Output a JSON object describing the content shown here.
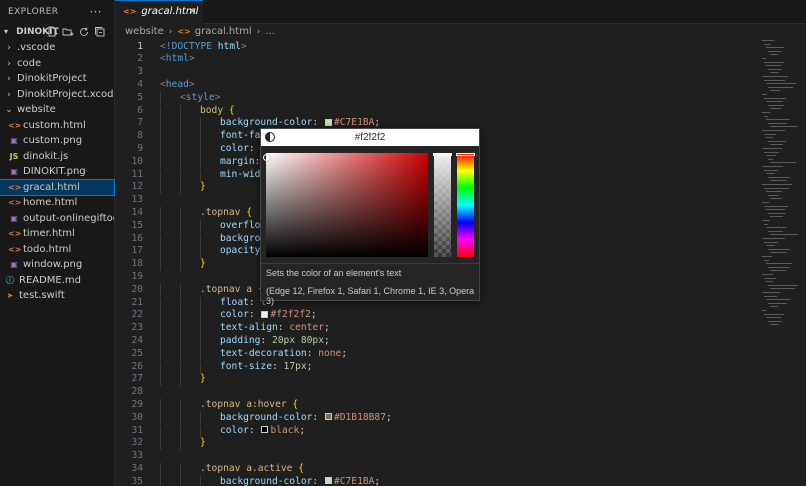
{
  "explorer": {
    "title": "EXPLORER",
    "more": "···",
    "section": "DINOKIT",
    "tree": [
      {
        "label": ".vscode",
        "type": "folder",
        "level": 0,
        "expanded": false
      },
      {
        "label": "code",
        "type": "folder",
        "level": 0,
        "expanded": false
      },
      {
        "label": "DinokitProject",
        "type": "folder",
        "level": 0,
        "expanded": false
      },
      {
        "label": "DinokitProject.xcode...",
        "type": "folder",
        "level": 0,
        "expanded": false
      },
      {
        "label": "website",
        "type": "folder",
        "level": 0,
        "expanded": true
      },
      {
        "label": "custom.html",
        "type": "html",
        "level": 1
      },
      {
        "label": "custom.png",
        "type": "image",
        "level": 1
      },
      {
        "label": "dinokit.js",
        "type": "js",
        "level": 1
      },
      {
        "label": "DINOKIT.png",
        "type": "image",
        "level": 1
      },
      {
        "label": "gracal.html",
        "type": "html",
        "level": 1,
        "selected": true
      },
      {
        "label": "home.html",
        "type": "html",
        "level": 1
      },
      {
        "label": "output-onlinegiftoo...",
        "type": "image",
        "level": 1
      },
      {
        "label": "timer.html",
        "type": "html",
        "level": 1
      },
      {
        "label": "todo.html",
        "type": "html",
        "level": 1
      },
      {
        "label": "window.png",
        "type": "image",
        "level": 1
      },
      {
        "label": "README.md",
        "type": "info",
        "level": 0
      },
      {
        "label": "test.swift",
        "type": "swift",
        "level": 0
      }
    ]
  },
  "tab": {
    "label": "gracal.html",
    "close": "×"
  },
  "breadcrumb": {
    "folder": "website",
    "file": "gracal.html",
    "more": "..."
  },
  "code_lines": [
    {
      "n": 1,
      "indent": 0,
      "parts": [
        [
          "punct",
          "<!"
        ],
        [
          "tag",
          "DOCTYPE"
        ],
        [
          "prop",
          " html"
        ],
        [
          "punct",
          ">"
        ]
      ]
    },
    {
      "n": 2,
      "indent": 0,
      "parts": [
        [
          "punct",
          "<"
        ],
        [
          "tag",
          "html"
        ],
        [
          "punct",
          ">"
        ]
      ]
    },
    {
      "n": 3,
      "indent": 0,
      "parts": []
    },
    {
      "n": 4,
      "indent": 0,
      "parts": [
        [
          "punct",
          "<"
        ],
        [
          "tag",
          "head"
        ],
        [
          "punct",
          ">"
        ]
      ]
    },
    {
      "n": 5,
      "indent": 1,
      "parts": [
        [
          "punct",
          "<"
        ],
        [
          "tag",
          "style"
        ],
        [
          "punct",
          ">"
        ]
      ]
    },
    {
      "n": 6,
      "indent": 2,
      "parts": [
        [
          "sel",
          "body "
        ],
        [
          "brace",
          "{"
        ]
      ]
    },
    {
      "n": 7,
      "indent": 3,
      "parts": [
        [
          "prop",
          "background-color"
        ],
        [
          "plain",
          ": "
        ],
        [
          "swatch",
          "#C7E1BA"
        ],
        [
          "val",
          "#C7E1BA"
        ],
        [
          "plain",
          ";"
        ]
      ]
    },
    {
      "n": 8,
      "indent": 3,
      "parts": [
        [
          "prop",
          "font-fam"
        ]
      ]
    },
    {
      "n": 9,
      "indent": 3,
      "parts": [
        [
          "prop",
          "color"
        ],
        [
          "plain",
          ": "
        ],
        [
          "swatch",
          "#f2f2f2"
        ]
      ]
    },
    {
      "n": 10,
      "indent": 3,
      "parts": [
        [
          "prop",
          "margin"
        ],
        [
          "plain",
          ":"
        ]
      ]
    },
    {
      "n": 11,
      "indent": 3,
      "parts": [
        [
          "prop",
          "min-widt"
        ]
      ]
    },
    {
      "n": 12,
      "indent": 2,
      "parts": [
        [
          "brace",
          "}"
        ]
      ]
    },
    {
      "n": 13,
      "indent": 0,
      "parts": []
    },
    {
      "n": 14,
      "indent": 2,
      "parts": [
        [
          "sel",
          ".topnav "
        ],
        [
          "brace",
          "{"
        ]
      ]
    },
    {
      "n": 15,
      "indent": 3,
      "parts": [
        [
          "prop",
          "overflow"
        ]
      ]
    },
    {
      "n": 16,
      "indent": 3,
      "parts": [
        [
          "prop",
          "backgrou"
        ]
      ]
    },
    {
      "n": 17,
      "indent": 3,
      "parts": [
        [
          "prop",
          "opacity"
        ],
        [
          "plain",
          ":"
        ]
      ]
    },
    {
      "n": 18,
      "indent": 2,
      "parts": [
        [
          "brace",
          "}"
        ]
      ]
    },
    {
      "n": 19,
      "indent": 0,
      "parts": []
    },
    {
      "n": 20,
      "indent": 2,
      "parts": [
        [
          "sel",
          ".topnav a "
        ],
        [
          "brace",
          "{"
        ]
      ]
    },
    {
      "n": 21,
      "indent": 3,
      "parts": [
        [
          "prop",
          "float"
        ],
        [
          "plain",
          ": "
        ],
        [
          "val",
          "l"
        ]
      ]
    },
    {
      "n": 22,
      "indent": 3,
      "parts": [
        [
          "prop",
          "color"
        ],
        [
          "plain",
          ": "
        ],
        [
          "swatch",
          "#f2f2f2"
        ],
        [
          "val",
          "#f2f2f2"
        ],
        [
          "plain",
          ";"
        ]
      ]
    },
    {
      "n": 23,
      "indent": 3,
      "parts": [
        [
          "prop",
          "text-align"
        ],
        [
          "plain",
          ": "
        ],
        [
          "val",
          "center"
        ],
        [
          "plain",
          ";"
        ]
      ]
    },
    {
      "n": 24,
      "indent": 3,
      "parts": [
        [
          "prop",
          "padding"
        ],
        [
          "plain",
          ": "
        ],
        [
          "num",
          "20px 80px"
        ],
        [
          "plain",
          ";"
        ]
      ]
    },
    {
      "n": 25,
      "indent": 3,
      "parts": [
        [
          "prop",
          "text-decoration"
        ],
        [
          "plain",
          ": "
        ],
        [
          "val",
          "none"
        ],
        [
          "plain",
          ";"
        ]
      ]
    },
    {
      "n": 26,
      "indent": 3,
      "parts": [
        [
          "prop",
          "font-size"
        ],
        [
          "plain",
          ": "
        ],
        [
          "num",
          "17px"
        ],
        [
          "plain",
          ";"
        ]
      ]
    },
    {
      "n": 27,
      "indent": 2,
      "parts": [
        [
          "brace",
          "}"
        ]
      ]
    },
    {
      "n": 28,
      "indent": 0,
      "parts": []
    },
    {
      "n": 29,
      "indent": 2,
      "parts": [
        [
          "sel",
          ".topnav a:hover "
        ],
        [
          "brace",
          "{"
        ]
      ]
    },
    {
      "n": 30,
      "indent": 3,
      "parts": [
        [
          "prop",
          "background-color"
        ],
        [
          "plain",
          ": "
        ],
        [
          "swatch",
          "#D1B18B87"
        ],
        [
          "val",
          "#D1B18B87"
        ],
        [
          "plain",
          ";"
        ]
      ]
    },
    {
      "n": 31,
      "indent": 3,
      "parts": [
        [
          "prop",
          "color"
        ],
        [
          "plain",
          ": "
        ],
        [
          "swatch",
          "black"
        ],
        [
          "val",
          "black"
        ],
        [
          "plain",
          ";"
        ]
      ]
    },
    {
      "n": 32,
      "indent": 2,
      "parts": [
        [
          "brace",
          "}"
        ]
      ]
    },
    {
      "n": 33,
      "indent": 0,
      "parts": []
    },
    {
      "n": 34,
      "indent": 2,
      "parts": [
        [
          "sel",
          ".topnav a.active "
        ],
        [
          "brace",
          "{"
        ]
      ]
    },
    {
      "n": 35,
      "indent": 3,
      "parts": [
        [
          "prop",
          "background-color"
        ],
        [
          "plain",
          ": "
        ],
        [
          "swatch",
          "#C7E1BA"
        ],
        [
          "val",
          "#C7E1BA"
        ],
        [
          "plain",
          ";"
        ]
      ]
    }
  ],
  "active_line": 1,
  "color_picker": {
    "hex": "#f2f2f2",
    "selected_color": "#f2f2f2",
    "hue_color": "#ff0000",
    "opacity": 1.0,
    "description": "Sets the color of an element's text",
    "compat": "(Edge 12, Firefox 1, Safari 1, Chrome 1, IE 3, Opera 3)"
  },
  "colors": {
    "accent": "#0078d4",
    "editor_bg": "#1f1f1f",
    "sidebar_bg": "#181818",
    "html_icon": "#e37933",
    "js_icon": "#cbcb41",
    "image_icon": "#a074c4",
    "info_icon": "#519aba",
    "swift_icon": "#e37933"
  }
}
